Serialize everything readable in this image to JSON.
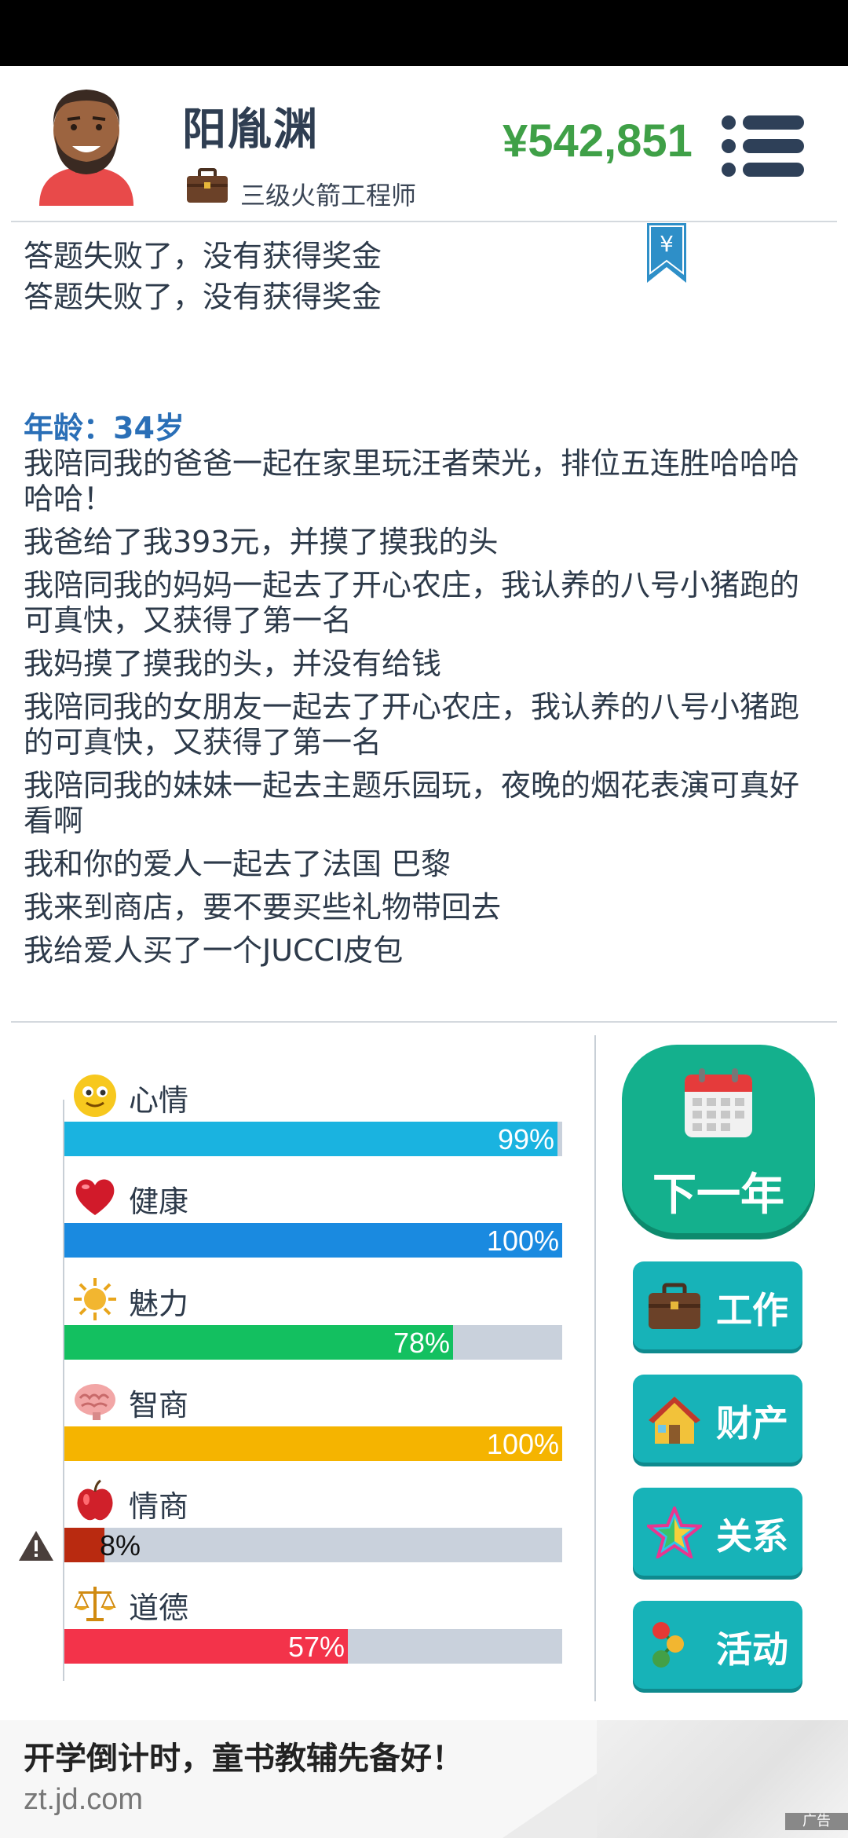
{
  "player": {
    "name": "阳胤渊",
    "job_title": "三级火箭工程师",
    "money": "¥542,851"
  },
  "log_top": [
    "答题失败了，没有获得奖金",
    "答题失败了，没有获得奖金"
  ],
  "story": {
    "age": "年龄：34岁",
    "items": [
      "我陪同我的爸爸一起在家里玩汪者荣光，排位五连胜哈哈哈哈哈！",
      "我爸给了我393元，并摸了摸我的头",
      "我陪同我的妈妈一起去了开心农庄，我认养的八号小猪跑的可真快，又获得了第一名",
      "我妈摸了摸我的头，并没有给钱",
      "我陪同我的女朋友一起去了开心农庄，我认养的八号小猪跑的可真快，又获得了第一名",
      "我陪同我的妹妹一起去主题乐园玩，夜晚的烟花表演可真好看啊",
      "我和你的爱人一起去了法国 巴黎",
      "我来到商店，要不要买些礼物带回去",
      "我给爱人买了一个JUCCI皮包"
    ]
  },
  "stats": [
    {
      "label": "心情",
      "value": 99,
      "text": "99%",
      "color": "#1ab3e0",
      "icon": "smiley-icon"
    },
    {
      "label": "健康",
      "value": 100,
      "text": "100%",
      "color": "#1a8ae0",
      "icon": "heart-icon"
    },
    {
      "label": "魅力",
      "value": 78,
      "text": "78%",
      "color": "#13c060",
      "icon": "sun-icon"
    },
    {
      "label": "智商",
      "value": 100,
      "text": "100%",
      "color": "#f5b400",
      "icon": "brain-icon"
    },
    {
      "label": "情商",
      "value": 8,
      "text": "8%",
      "color": "#b92a10",
      "icon": "apple-icon",
      "warning": true
    },
    {
      "label": "道德",
      "value": 57,
      "text": "57%",
      "color": "#f3334a",
      "icon": "scales-icon"
    }
  ],
  "actions": {
    "next_year": "下一年",
    "work": "工作",
    "property": "财产",
    "relations": "关系",
    "activities": "活动"
  },
  "ad": {
    "title": "开学倒计时，童书教辅先备好！",
    "url": "zt.jd.com",
    "tag": "广告"
  }
}
